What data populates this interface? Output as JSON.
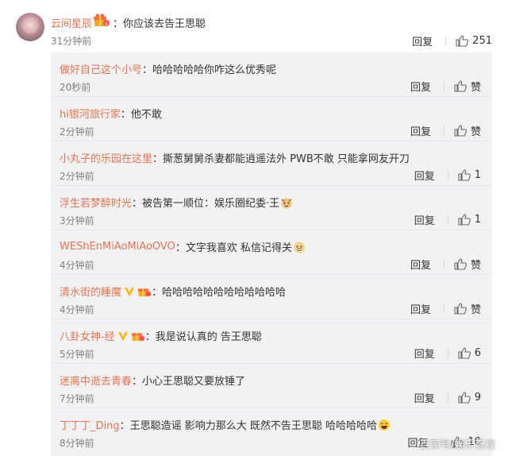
{
  "top": {
    "name": "云间星辰",
    "text": "：你应该去告王思聪",
    "time": "31分钟前",
    "reply": "回复",
    "likes": "251"
  },
  "replies": [
    {
      "name": "做好自己这个小号",
      "text": "：哈哈哈哈哈你咋这么优秀呢",
      "time": "20秒前",
      "reply": "回复",
      "likes": "赞"
    },
    {
      "name": "hi银河旅行家",
      "text": "：他不敢",
      "time": "2分钟前",
      "reply": "回复",
      "likes": "赞"
    },
    {
      "name": "小丸子的乐园在这里",
      "text": "：撕葱舅舅杀妻都能逍遥法外 PWB不敢 只能拿网友开刀",
      "time": "2分钟前",
      "reply": "回复",
      "likes": "1"
    },
    {
      "name": "浮生若梦醉时光",
      "text": "：被告第一顺位：娱乐圈纪委·王",
      "time": "3分钟前",
      "reply": "回复",
      "likes": "1"
    },
    {
      "name": "WEShEnMiAoMiAoOVO",
      "text": "：文字我喜欢 私信记得关",
      "time": "4分钟前",
      "reply": "回复",
      "likes": "赞"
    },
    {
      "name": "清水街的睡魔",
      "text": "：哈哈哈哈哈哈哈哈哈哈哈哈",
      "time": "4分钟前",
      "reply": "回复",
      "likes": "赞"
    },
    {
      "name": "八卦女神-经",
      "text": "：我是说认真的 告王思聪",
      "time": "5分钟前",
      "reply": "回复",
      "likes": "6"
    },
    {
      "name": "迷离中逝去青春",
      "text": "：小心王思聪又要放锤了",
      "time": "7分钟前",
      "reply": "回复",
      "likes": "9"
    },
    {
      "name": "丁丁丁_Ding",
      "text": "：王思聪造谣 影响力那么大 既然不告王思聪 哈哈哈哈哈",
      "time": "8分钟前",
      "reply": "回复",
      "likes": "10"
    }
  ],
  "watermark": "百家号/娱乐直视",
  "colors": {
    "username": "#eb7350",
    "subbg": "#f2f2f5",
    "gray": "#808080"
  }
}
